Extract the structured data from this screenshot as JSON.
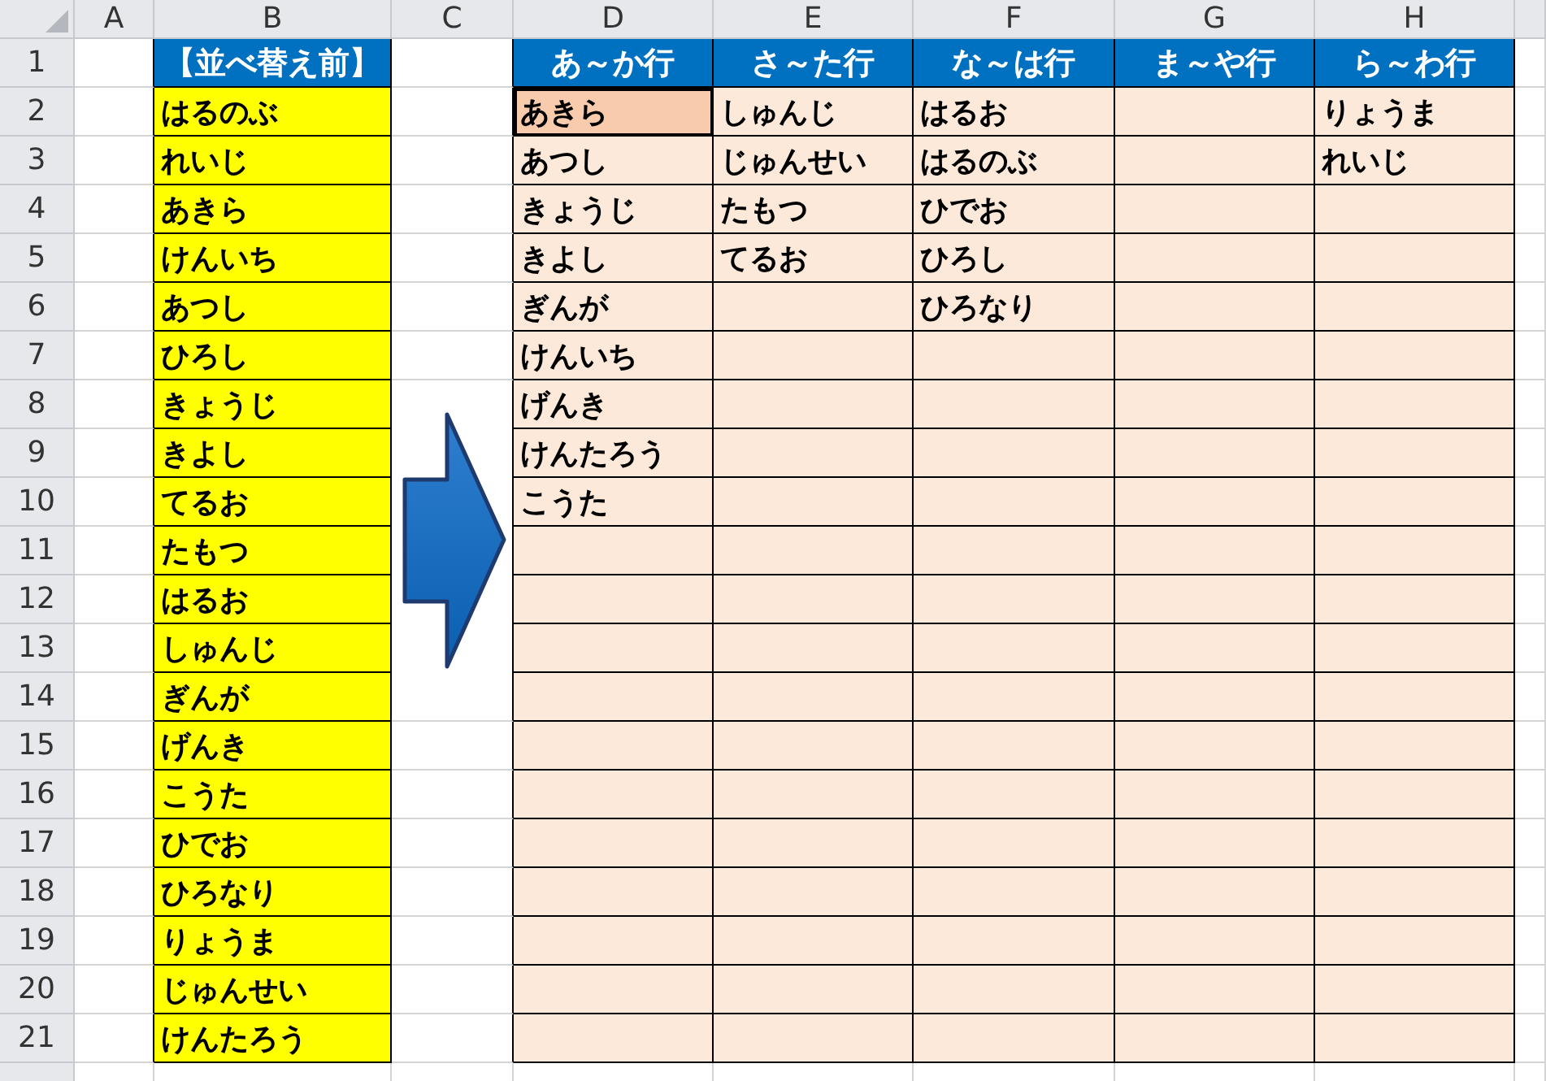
{
  "column_headers": [
    "A",
    "B",
    "C",
    "D",
    "E",
    "F",
    "G",
    "H"
  ],
  "row_numbers": [
    "1",
    "2",
    "3",
    "4",
    "5",
    "6",
    "7",
    "8",
    "9",
    "10",
    "11",
    "12",
    "13",
    "14",
    "15",
    "16",
    "17",
    "18",
    "19",
    "20",
    "21"
  ],
  "before_list": {
    "title": "【並べ替え前】",
    "names": [
      "はるのぶ",
      "れいじ",
      "あきら",
      "けんいち",
      "あつし",
      "ひろし",
      "きょうじ",
      "きよし",
      "てるお",
      "たもつ",
      "はるお",
      "しゅんじ",
      "ぎんが",
      "げんき",
      "こうた",
      "ひでお",
      "ひろなり",
      "りょうま",
      "じゅんせい",
      "けんたろう"
    ]
  },
  "result_table": {
    "headers": [
      "あ～か行",
      "さ～た行",
      "な～は行",
      "ま～や行",
      "ら～わ行"
    ],
    "rows": [
      {
        "cells": [
          {
            "text": "あきら",
            "selected": true
          },
          {
            "text": "しゅんじ",
            "selected": false
          },
          {
            "text": "はるお",
            "selected": false
          },
          {
            "selected": false
          },
          {
            "text": "りょうま",
            "selected": false
          }
        ]
      },
      {
        "cells": [
          {
            "text": "あつし",
            "selected": false
          },
          {
            "text": "じゅんせい",
            "selected": false
          },
          {
            "text": "はるのぶ",
            "selected": false
          },
          {
            "selected": false
          },
          {
            "text": "れいじ",
            "selected": false
          }
        ]
      },
      {
        "cells": [
          {
            "text": "きょうじ",
            "selected": false
          },
          {
            "text": "たもつ",
            "selected": false
          },
          {
            "text": "ひでお",
            "selected": false
          },
          {
            "selected": false
          },
          {
            "selected": false
          }
        ]
      },
      {
        "cells": [
          {
            "text": "きよし",
            "selected": false
          },
          {
            "text": "てるお",
            "selected": false
          },
          {
            "text": "ひろし",
            "selected": false
          },
          {
            "selected": false
          },
          {
            "selected": false
          }
        ]
      },
      {
        "cells": [
          {
            "text": "ぎんが",
            "selected": false
          },
          {
            "selected": false
          },
          {
            "text": "ひろなり",
            "selected": false
          },
          {
            "selected": false
          },
          {
            "selected": false
          }
        ]
      },
      {
        "cells": [
          {
            "text": "けんいち",
            "selected": false
          },
          {
            "selected": false
          },
          {
            "selected": false
          },
          {
            "selected": false
          },
          {
            "selected": false
          }
        ]
      },
      {
        "cells": [
          {
            "text": "げんき",
            "selected": false
          },
          {
            "selected": false
          },
          {
            "selected": false
          },
          {
            "selected": false
          },
          {
            "selected": false
          }
        ]
      },
      {
        "cells": [
          {
            "text": "けんたろう",
            "selected": false
          },
          {
            "selected": false
          },
          {
            "selected": false
          },
          {
            "selected": false
          },
          {
            "selected": false
          }
        ]
      },
      {
        "cells": [
          {
            "text": "こうた",
            "selected": false
          },
          {
            "selected": false
          },
          {
            "selected": false
          },
          {
            "selected": false
          },
          {
            "selected": false
          }
        ]
      },
      {
        "cells": [
          {
            "selected": false
          },
          {
            "selected": false
          },
          {
            "selected": false
          },
          {
            "selected": false
          },
          {
            "selected": false
          }
        ]
      },
      {
        "cells": [
          {
            "selected": false
          },
          {
            "selected": false
          },
          {
            "selected": false
          },
          {
            "selected": false
          },
          {
            "selected": false
          }
        ]
      },
      {
        "cells": [
          {
            "selected": false
          },
          {
            "selected": false
          },
          {
            "selected": false
          },
          {
            "selected": false
          },
          {
            "selected": false
          }
        ]
      },
      {
        "cells": [
          {
            "selected": false
          },
          {
            "selected": false
          },
          {
            "selected": false
          },
          {
            "selected": false
          },
          {
            "selected": false
          }
        ]
      },
      {
        "cells": [
          {
            "selected": false
          },
          {
            "selected": false
          },
          {
            "selected": false
          },
          {
            "selected": false
          },
          {
            "selected": false
          }
        ]
      },
      {
        "cells": [
          {
            "selected": false
          },
          {
            "selected": false
          },
          {
            "selected": false
          },
          {
            "selected": false
          },
          {
            "selected": false
          }
        ]
      },
      {
        "cells": [
          {
            "selected": false
          },
          {
            "selected": false
          },
          {
            "selected": false
          },
          {
            "selected": false
          },
          {
            "selected": false
          }
        ]
      },
      {
        "cells": [
          {
            "selected": false
          },
          {
            "selected": false
          },
          {
            "selected": false
          },
          {
            "selected": false
          },
          {
            "selected": false
          }
        ]
      },
      {
        "cells": [
          {
            "selected": false
          },
          {
            "selected": false
          },
          {
            "selected": false
          },
          {
            "selected": false
          },
          {
            "selected": false
          }
        ]
      },
      {
        "cells": [
          {
            "selected": false
          },
          {
            "selected": false
          },
          {
            "selected": false
          },
          {
            "selected": false
          },
          {
            "selected": false
          }
        ]
      },
      {
        "cells": [
          {
            "selected": false
          },
          {
            "selected": false
          },
          {
            "selected": false
          },
          {
            "selected": false
          },
          {
            "selected": false
          }
        ]
      }
    ]
  }
}
